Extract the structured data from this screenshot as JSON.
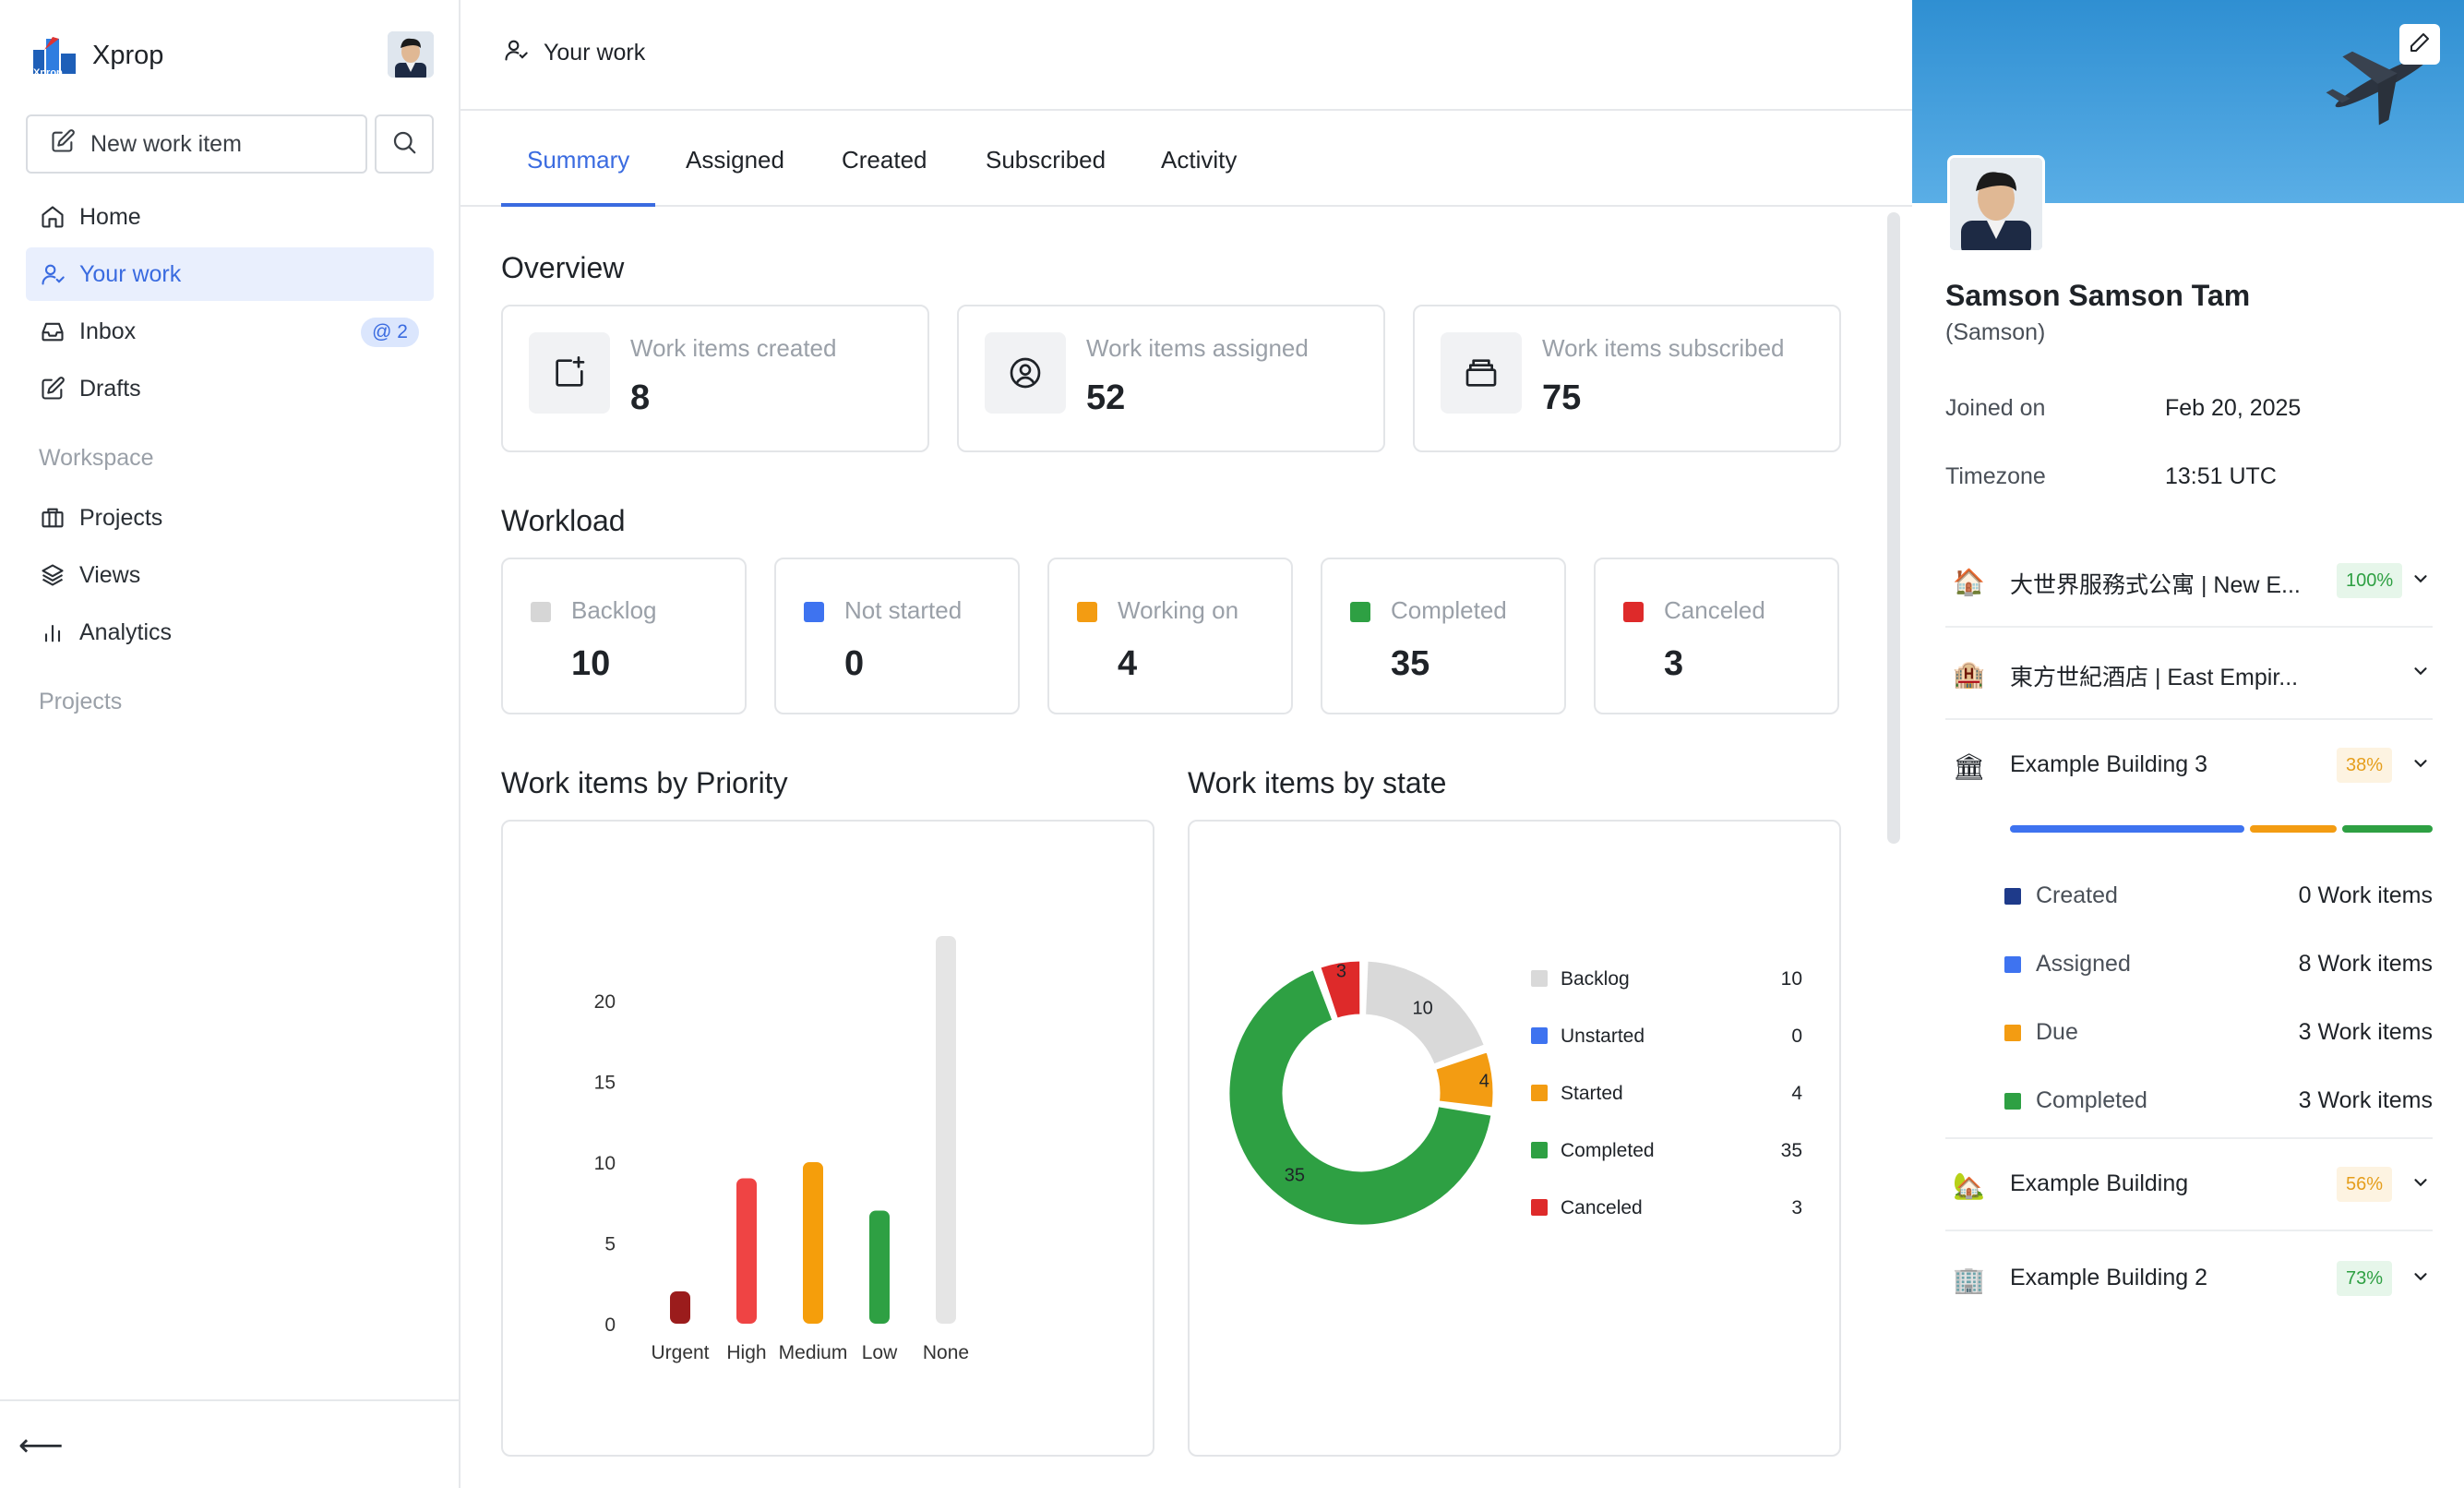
{
  "app": {
    "name": "Xprop"
  },
  "sidebar": {
    "new_item_label": "New work item",
    "nav": [
      {
        "label": "Home",
        "icon": "home-icon"
      },
      {
        "label": "Your work",
        "icon": "user-icon",
        "active": true
      },
      {
        "label": "Inbox",
        "icon": "inbox-icon",
        "badge": "@ 2"
      },
      {
        "label": "Drafts",
        "icon": "edit-icon"
      }
    ],
    "workspace_heading": "Workspace",
    "workspace_nav": [
      {
        "label": "Projects",
        "icon": "briefcase-icon"
      },
      {
        "label": "Views",
        "icon": "layers-icon"
      },
      {
        "label": "Analytics",
        "icon": "bar-chart-icon"
      }
    ],
    "projects_heading": "Projects",
    "collapse_glyph": "⟵"
  },
  "header": {
    "breadcrumb": "Your work"
  },
  "tabs": [
    "Summary",
    "Assigned",
    "Created",
    "Subscribed",
    "Activity"
  ],
  "overview": {
    "title": "Overview",
    "cards": [
      {
        "label": "Work items created",
        "value": "8"
      },
      {
        "label": "Work items assigned",
        "value": "52"
      },
      {
        "label": "Work items subscribed",
        "value": "75"
      }
    ]
  },
  "workload": {
    "title": "Workload",
    "cards": [
      {
        "label": "Backlog",
        "value": "10",
        "color": "#d6d6d6"
      },
      {
        "label": "Not started",
        "value": "0",
        "color": "#3e73f0"
      },
      {
        "label": "Working on",
        "value": "4",
        "color": "#f39c12"
      },
      {
        "label": "Completed",
        "value": "35",
        "color": "#2ea043"
      },
      {
        "label": "Canceled",
        "value": "3",
        "color": "#de2a2a"
      }
    ]
  },
  "priority_title": "Work items by Priority",
  "state_title": "Work items by state",
  "chart_data": [
    {
      "type": "bar",
      "categories": [
        "Urgent",
        "High",
        "Medium",
        "Low",
        "None"
      ],
      "values": [
        2,
        9,
        10,
        7,
        24
      ],
      "colors": [
        "#9b1c1c",
        "#ef4444",
        "#f59e0b",
        "#2ea043",
        "#e5e5e5"
      ],
      "y_ticks": [
        0,
        5,
        10,
        15,
        20
      ],
      "ylim": [
        0,
        24
      ],
      "title": "Work items by Priority"
    },
    {
      "type": "pie",
      "categories": [
        "Backlog",
        "Unstarted",
        "Started",
        "Completed",
        "Canceled"
      ],
      "values": [
        10,
        0,
        4,
        35,
        3
      ],
      "colors": [
        "#d9d9d9",
        "#3e73f0",
        "#f39c12",
        "#2ea043",
        "#de2a2a"
      ],
      "title": "Work items by state"
    }
  ],
  "profile": {
    "name": "Samson Samson Tam",
    "nickname": "(Samson)",
    "joined_label": "Joined on",
    "joined_value": "Feb 20, 2025",
    "timezone_label": "Timezone",
    "timezone_value": "13:51 UTC",
    "buildings": [
      {
        "name": "大世界服務式公寓 | New E...",
        "pct": "100%",
        "icon": "🏠",
        "pct_bg": "#e6f6ea",
        "pct_color": "#2ea043"
      },
      {
        "name": "東方世紀酒店 | East Empir...",
        "pct": "",
        "icon": "🏨",
        "pct_bg": "transparent",
        "pct_color": "#2ea043"
      },
      {
        "name": "Example Building 3",
        "pct": "38%",
        "icon": "🏛",
        "pct_bg": "#fdf3e1",
        "pct_color": "#e59e1c",
        "expanded": true
      },
      {
        "name": "Example Building",
        "pct": "56%",
        "icon": "🏡",
        "pct_bg": "#fdf3e1",
        "pct_color": "#e59e1c"
      },
      {
        "name": "Example Building 2",
        "pct": "73%",
        "icon": "🏢",
        "pct_bg": "#e6f6ea",
        "pct_color": "#2ea043"
      }
    ],
    "expanded_stats": [
      {
        "label": "Created",
        "value": "0 Work items",
        "color": "#1e3a8a"
      },
      {
        "label": "Assigned",
        "value": "8 Work items",
        "color": "#3e73f0"
      },
      {
        "label": "Due",
        "value": "3 Work items",
        "color": "#f39c12"
      },
      {
        "label": "Completed",
        "value": "3 Work items",
        "color": "#2ea043"
      }
    ],
    "progress_segments": [
      {
        "fraction": 0.57,
        "color": "#3e73f0"
      },
      {
        "fraction": 0.21,
        "color": "#f39c12"
      },
      {
        "fraction": 0.22,
        "color": "#2ea043"
      }
    ]
  }
}
